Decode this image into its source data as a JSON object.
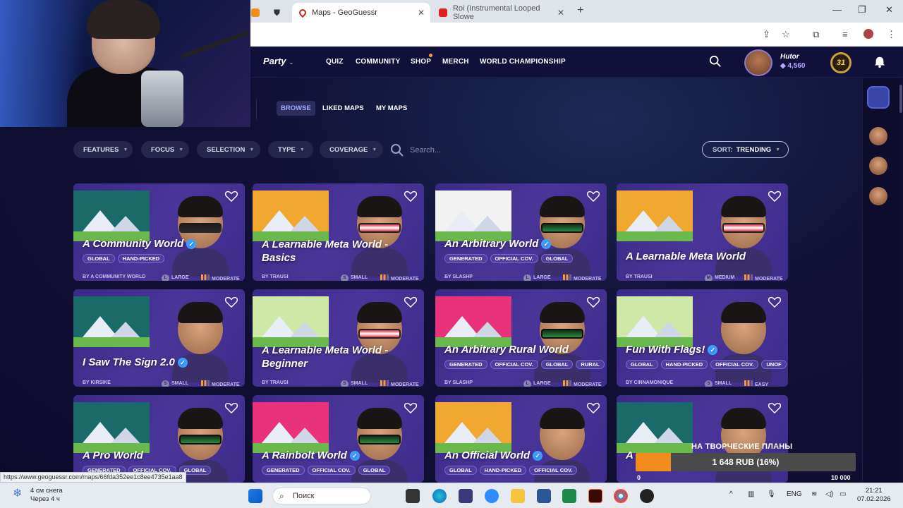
{
  "browser": {
    "tabs": [
      {
        "title": "Maps - GeoGuessr",
        "active": true
      },
      {
        "title": "Roi (Instrumental Looped Slowe",
        "active": false
      }
    ]
  },
  "header": {
    "party": "Party",
    "nav": [
      "QUIZ",
      "COMMUNITY",
      "SHOP",
      "MERCH",
      "WORLD CHAMPIONSHIP"
    ],
    "username": "Hutor",
    "coins": "4,560",
    "level": "31"
  },
  "subtabs": [
    "BROWSE",
    "LIKED MAPS",
    "MY MAPS"
  ],
  "filters": [
    "FEATURES",
    "FOCUS",
    "SELECTION",
    "TYPE",
    "COVERAGE"
  ],
  "search_placeholder": "Search...",
  "sort": {
    "label": "SORT:",
    "value": "TRENDING"
  },
  "cards": [
    {
      "title": "A Community World",
      "verified": true,
      "tags": [
        "GLOBAL",
        "HAND-PICKED"
      ],
      "by": "BY A COMMUNITY WORLD",
      "size": "LARGE",
      "difficulty": "MODERATE"
    },
    {
      "title": "A Learnable Meta World -",
      "title2": "Basics",
      "verified": false,
      "tags": [],
      "by": "BY TRAUSI",
      "size": "SMALL",
      "difficulty": "MODERATE"
    },
    {
      "title": "An Arbitrary World",
      "verified": true,
      "tags": [
        "GENERATED",
        "OFFICIAL COV.",
        "GLOBAL"
      ],
      "by": "BY SLASHP",
      "size": "LARGE",
      "difficulty": "MODERATE"
    },
    {
      "title": "A Learnable Meta World",
      "verified": false,
      "tags": [],
      "by": "BY TRAUSI",
      "size": "MEDIUM",
      "difficulty": "MODERATE"
    },
    {
      "title": "I Saw The Sign 2.0",
      "verified": true,
      "tags": [],
      "by": "BY KIRSIKE",
      "size": "SMALL",
      "difficulty": "MODERATE"
    },
    {
      "title": "A Learnable Meta World -",
      "title2": "Beginner",
      "verified": false,
      "tags": [],
      "by": "BY TRAUSI",
      "size": "SMALL",
      "difficulty": "MODERATE"
    },
    {
      "title": "An Arbitrary Rural World",
      "verified": false,
      "tags": [
        "GENERATED",
        "OFFICIAL COV.",
        "GLOBAL",
        "RURAL"
      ],
      "by": "BY SLASHP",
      "size": "LARGE",
      "difficulty": "MODERATE"
    },
    {
      "title": "Fun With Flags!",
      "verified": true,
      "tags": [
        "GLOBAL",
        "HAND-PICKED",
        "OFFICIAL COV.",
        "UNOF"
      ],
      "by": "BY CINNAMONIQUE",
      "size": "SMALL",
      "difficulty": "EASY"
    },
    {
      "title": "A Pro World",
      "verified": false,
      "tags": [
        "GENERATED",
        "OFFICIAL COV.",
        "GLOBAL"
      ]
    },
    {
      "title": "A Rainbolt World",
      "verified": true,
      "tags": [
        "GENERATED",
        "OFFICIAL COV.",
        "GLOBAL"
      ]
    },
    {
      "title": "An Official World",
      "verified": true,
      "tags": [
        "GLOBAL",
        "HAND-PICKED",
        "OFFICIAL COV."
      ]
    },
    {
      "title": "A",
      "verified": false,
      "tags": []
    }
  ],
  "donation": {
    "title": "НА ТВОРЧЕСКИЕ ПЛАНЫ",
    "text": "1 648 RUB (16%)",
    "progress": 0.16,
    "min": "0",
    "max": "10 000",
    "color": "#f28c1d"
  },
  "status_url": "https://www.geoguessr.com/maps/66fda352ee1c8ee4735e1aa8",
  "taskbar": {
    "weather_line1": "4 см снега",
    "weather_line2": "Через 4 ч",
    "search": "Поиск",
    "lang": "ENG",
    "time": "21:21",
    "date": "07.02.2026"
  }
}
